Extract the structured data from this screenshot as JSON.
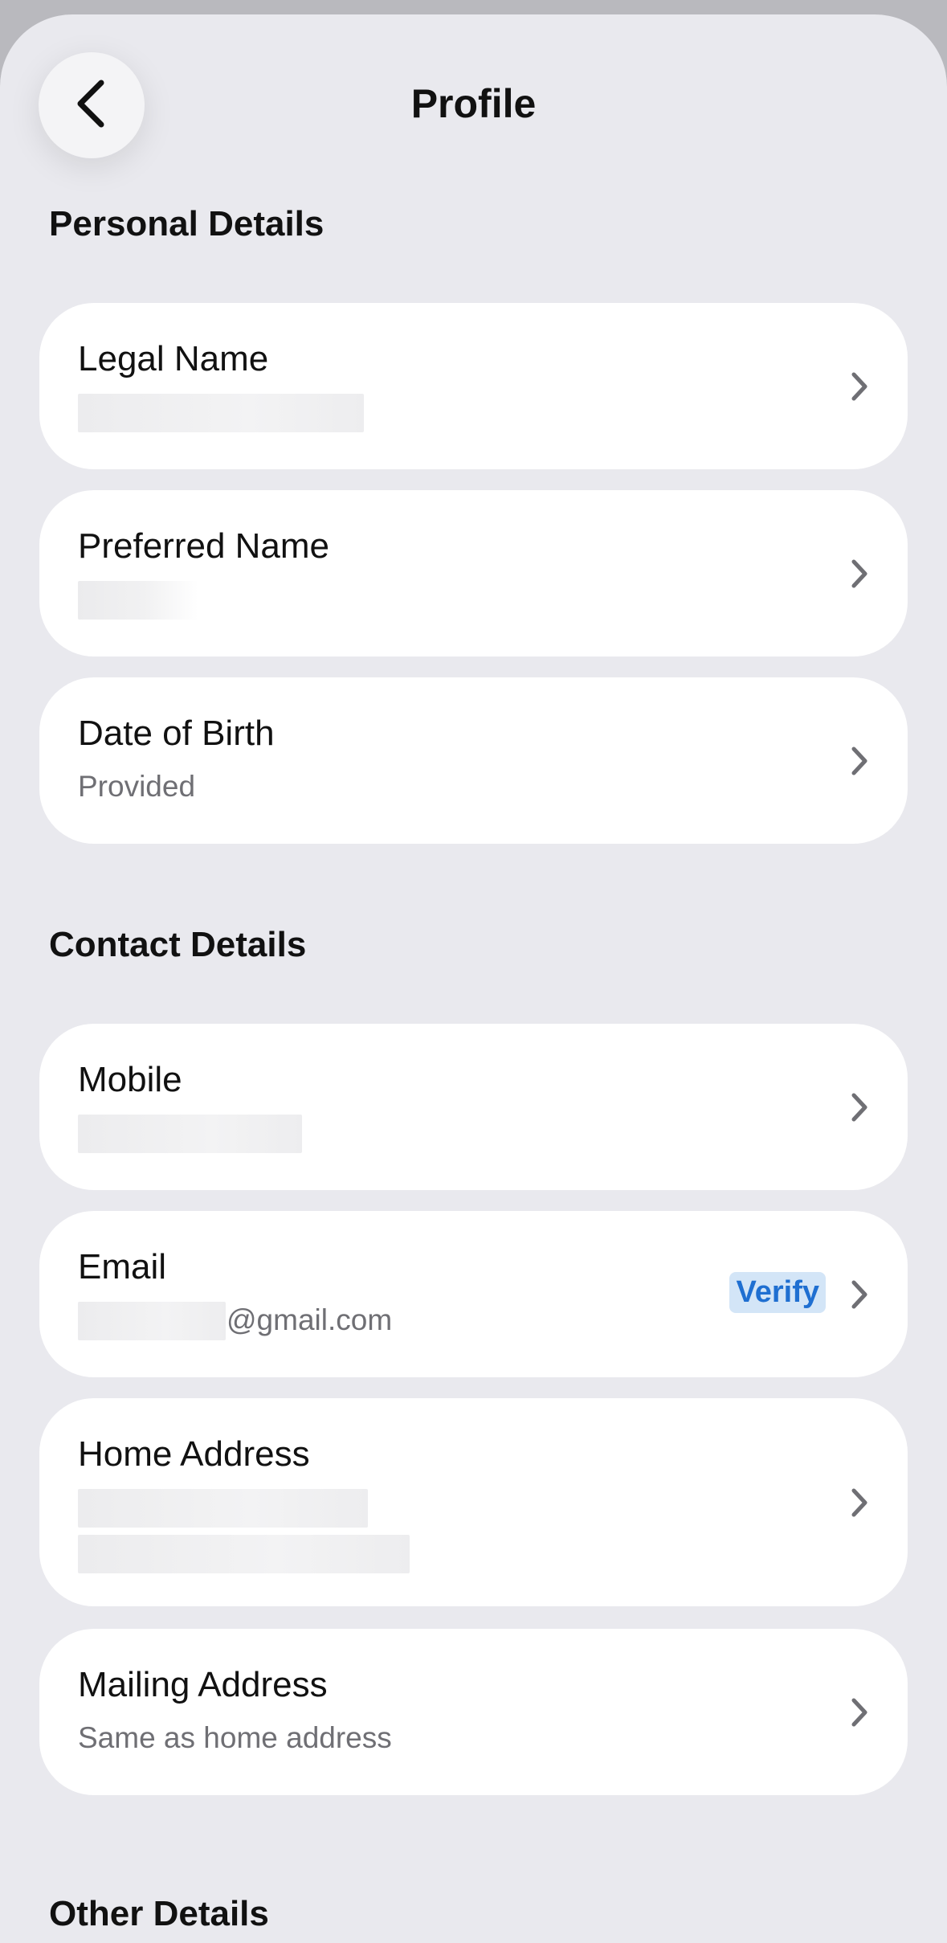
{
  "header": {
    "title": "Profile",
    "back_icon": "chevron-left-icon"
  },
  "sections": {
    "personal": "Personal Details",
    "contact": "Contact Details",
    "other": "Other Details"
  },
  "rows": {
    "legal_name": {
      "label": "Legal Name",
      "value_redacted": true
    },
    "preferred_name": {
      "label": "Preferred Name",
      "value_redacted": true
    },
    "date_of_birth": {
      "label": "Date of Birth",
      "value": "Provided"
    },
    "mobile": {
      "label": "Mobile",
      "value_redacted": true
    },
    "email": {
      "label": "Email",
      "value_suffix": "@gmail.com",
      "badge": "Verify"
    },
    "home_address": {
      "label": "Home Address",
      "value_redacted": true
    },
    "mailing_address": {
      "label": "Mailing Address",
      "value": "Same as home address"
    }
  },
  "colors": {
    "background": "#e9e9ee",
    "card": "#ffffff",
    "accent": "#1f6fd1",
    "badge_bg": "#d3e5f7",
    "secondary_text": "#6f6f74"
  }
}
